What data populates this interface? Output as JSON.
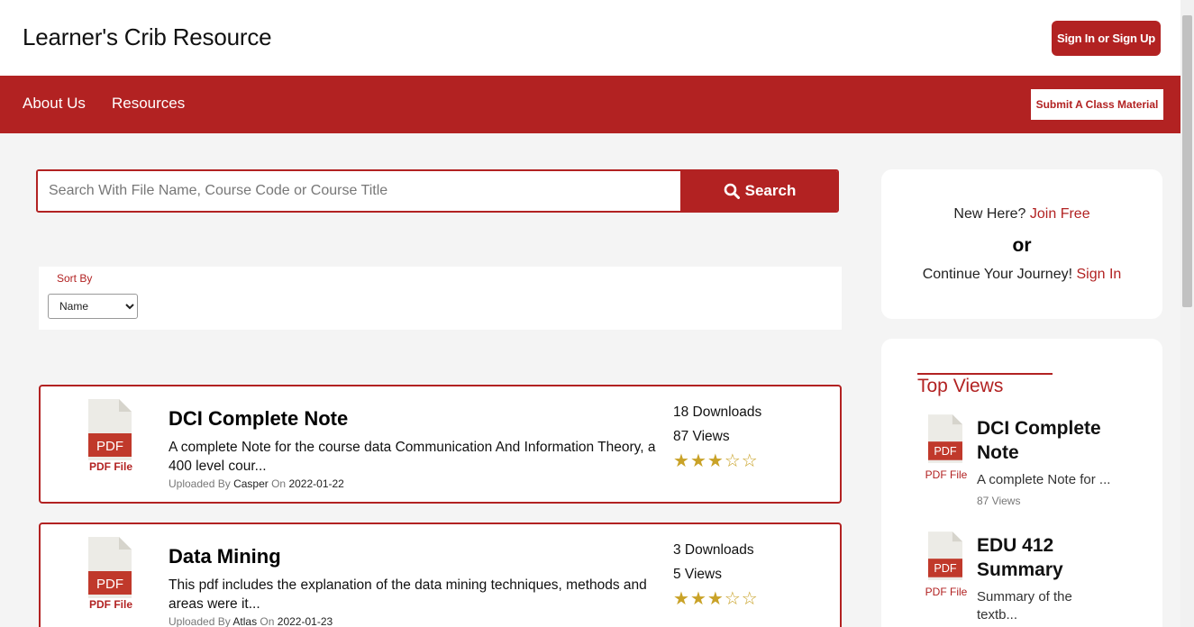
{
  "header": {
    "brand": "Learner's Crib Resource",
    "signin_label": "Sign In or Sign Up"
  },
  "nav": {
    "items": [
      {
        "label": "About Us"
      },
      {
        "label": "Resources"
      }
    ],
    "submit_label": "Submit A Class Material"
  },
  "search": {
    "placeholder": "Search With File Name, Course Code or Course Title",
    "value": "",
    "button_label": "Search"
  },
  "sort": {
    "label": "Sort By",
    "selected": "Name"
  },
  "files": [
    {
      "title": "DCI Complete Note",
      "description": "A complete Note for the course data Communication And Information Theory, a 400 level cour...",
      "file_type": "PDF File",
      "icon_text": "PDF",
      "uploaded_prefix": "Uploaded By",
      "uploader": "Casper",
      "on_label": "On",
      "date": "2022-01-22",
      "downloads": "18 Downloads",
      "views": "87 Views",
      "rating": 3,
      "rating_max": 5
    },
    {
      "title": "Data Mining",
      "description": "This pdf includes the explanation of the data mining techniques, methods and areas were it...",
      "file_type": "PDF File",
      "icon_text": "PDF",
      "uploaded_prefix": "Uploaded By",
      "uploader": "Atlas",
      "on_label": "On",
      "date": "2022-01-23",
      "downloads": "3 Downloads",
      "views": "5 Views",
      "rating": 3,
      "rating_max": 5
    }
  ],
  "join": {
    "line1_prefix": "New Here?",
    "line1_link": "Join Free",
    "or": "or",
    "line2_prefix": "Continue Your Journey!",
    "line2_link": "Sign In"
  },
  "top_views": {
    "title": "Top Views",
    "items": [
      {
        "title_line1": "DCI Complete",
        "title_line2": "Note",
        "description": "A complete Note for ...",
        "views": "87 Views",
        "file_type": "PDF File",
        "icon_text": "PDF"
      },
      {
        "title_line1": "EDU 412",
        "title_line2": "Summary",
        "description_line1": "Summary of the",
        "description_line2": "textb...",
        "file_type": "PDF File",
        "icon_text": "PDF"
      }
    ]
  },
  "colors": {
    "brand": "#b22222",
    "star": "#c9a227",
    "background": "#f4f4f4"
  }
}
